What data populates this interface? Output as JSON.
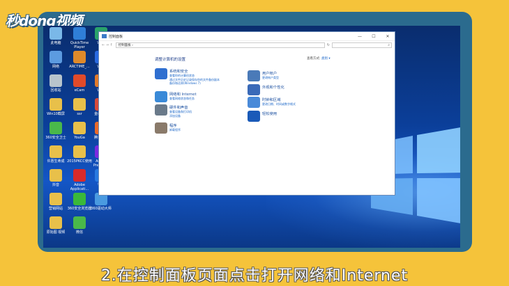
{
  "watermark": {
    "text": "秒dong视频"
  },
  "desktop_icons": [
    {
      "label": "此电脑",
      "color": "#7ab8e8"
    },
    {
      "label": "QuickTime Player",
      "color": "#2f7fd8"
    },
    {
      "label": "WPS",
      "color": "#2aa36a"
    },
    {
      "label": "网络",
      "color": "#5c9be0"
    },
    {
      "label": "ARCTIME_...",
      "color": "#e08a2a"
    },
    {
      "label": "WPS",
      "color": "#2a6ae0"
    },
    {
      "label": "回收站",
      "color": "#b8c4cc"
    },
    {
      "label": "eCam",
      "color": "#e04a2a"
    },
    {
      "label": "WPS",
      "color": "#e07a2a"
    },
    {
      "label": "Win10截屏",
      "color": "#e8c04a"
    },
    {
      "label": "ssr",
      "color": "#e8c04a"
    },
    {
      "label": "金山PDF",
      "color": "#d84a3a"
    },
    {
      "label": "360安全卫士",
      "color": "#4ab84a"
    },
    {
      "label": "YouGa",
      "color": "#e8c04a"
    },
    {
      "label": "腾讯视频",
      "color": "#e86a2a"
    },
    {
      "label": "许愿生命成",
      "color": "#e8c04a"
    },
    {
      "label": "2015PKCC使用",
      "color": "#e8c04a"
    },
    {
      "label": "Adobe Premiere",
      "color": "#7a2ae0"
    },
    {
      "label": "抖音",
      "color": "#e8c04a"
    },
    {
      "label": "Adobe Applicati...",
      "color": "#d82a2a"
    },
    {
      "label": "钉钉",
      "color": "#2a7ae0"
    },
    {
      "label": "营销网站",
      "color": "#e8c04a"
    },
    {
      "label": "360安全浏览器",
      "color": "#3ab83a"
    },
    {
      "label": "360驱动大师",
      "color": "#4a9ae0"
    },
    {
      "label": "原始图 视频",
      "color": "#e8c04a"
    },
    {
      "label": "微信",
      "color": "#4ab84a"
    }
  ],
  "window": {
    "title": "控制面板",
    "controls": [
      "—",
      "☐",
      "✕"
    ],
    "nav": "←  →  ↑",
    "address": "控制面板 ›",
    "refresh": "↻",
    "search_icon": "search-icon",
    "heading": "调整计算机的设置",
    "view_by_label": "查看方式:",
    "view_by_value": "类别 ▾"
  },
  "categories_left": [
    {
      "title": "系统和安全",
      "links": [
        "查看你的计算机状态",
        "通过文件历史记录保存你的文件备份副本",
        "备份和还原(Windows 7)"
      ],
      "icon_color": "#2f6fd0",
      "icon": "shield-icon"
    },
    {
      "title": "网络和 Internet",
      "links": [
        "查看网络状态和任务"
      ],
      "icon_color": "#3a8ad8",
      "icon": "network-globe-icon"
    },
    {
      "title": "硬件和声音",
      "links": [
        "查看设备和打印机",
        "添加设备"
      ],
      "icon_color": "#6a7a8a",
      "icon": "printer-icon"
    },
    {
      "title": "程序",
      "links": [
        "卸载程序"
      ],
      "icon_color": "#8a7a6a",
      "icon": "programs-icon"
    }
  ],
  "categories_right": [
    {
      "title": "用户帐户",
      "links": [
        "更改帐户类型"
      ],
      "icon_color": "#4a7ab8",
      "icon": "users-icon"
    },
    {
      "title": "外观和个性化",
      "links": [],
      "icon_color": "#3a6ab8",
      "icon": "appearance-icon"
    },
    {
      "title": "时钟和区域",
      "links": [
        "更改日期、时间或数字格式"
      ],
      "icon_color": "#4a8ad8",
      "icon": "clock-globe-icon"
    },
    {
      "title": "轻松使用",
      "links": [],
      "icon_color": "#1a5ab8",
      "icon": "ease-of-access-icon"
    }
  ],
  "caption": {
    "text": "2.在控制面板页面点击打开网络和Internet"
  }
}
